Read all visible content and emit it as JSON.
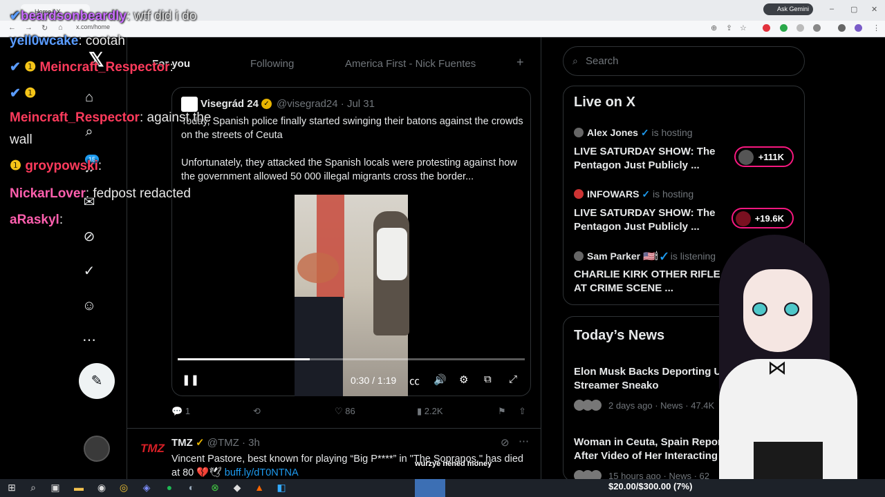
{
  "browser": {
    "tab_title": "Home / X",
    "url": "x.com/home",
    "gemini": "Ask Gemini"
  },
  "x": {
    "logo": "𝕏",
    "tabs": [
      "For you",
      "Following",
      "America First - Nick Fuentes"
    ],
    "add_tab": "+",
    "notif_count": "15",
    "quote": {
      "name": "Visegrád 24",
      "handle": "@visegrad24 · Jul 31",
      "text1": "Today, Spanish police finally started swinging their batons against the crowds on the streets of Ceuta",
      "text2": "Unfortunately, they attacked the Spanish locals were protesting against how the government allowed 50 000 illegal migrants cross the border..."
    },
    "video": {
      "time": "0:30 / 1:19",
      "progress": 0.38
    },
    "actions": {
      "replies": "1",
      "likes": "86",
      "views": "2.2K"
    },
    "tmz": {
      "logo": "TMZ",
      "name": "TMZ",
      "handle": "@TMZ · 3h",
      "text": "Vincent Pastore, best known for playing “Big P****” in \"The Sopranos,\" has died at 80 💔🕊",
      "link": "buff.ly/dT0NTNA"
    }
  },
  "right": {
    "search_placeholder": "Search",
    "live": {
      "title": "Live on X",
      "items": [
        {
          "host": "Alex Jones",
          "status": "is hosting",
          "title": "LIVE SATURDAY SHOW: The Pentagon Just Publicly ...",
          "count": "+111K"
        },
        {
          "host": "INFOWARS",
          "status": "is hosting",
          "title": "LIVE SATURDAY SHOW: The Pentagon Just Publicly ...",
          "count": "+19.6K"
        },
        {
          "host": "Sam Parker 🇺🇸🕯",
          "status": "is listening",
          "title": "CHARLIE KIRK OTHER RIFLE AT CRIME SCENE ..."
        }
      ]
    },
    "news": {
      "title": "Today’s News",
      "items": [
        {
          "title": "Elon Musk Backs Deporting U.S. Streamer Sneako",
          "meta": "2 days ago · News · 47.4K"
        },
        {
          "title": "Woman in Ceuta, Spain Report After Video of Her Interacting",
          "meta": "15 hours ago · News · 62"
        }
      ]
    }
  },
  "chat": [
    {
      "user": "beardsonbeardly",
      "color": "#c86bff",
      "msg": ": wtf did i do"
    },
    {
      "user": "yell0wcake",
      "color": "#5a9cff",
      "msg": ": cootah"
    },
    {
      "user": "Meincraft_Respector",
      "color": "#ff3b5c",
      "msg": ":"
    },
    {
      "user": "Meincraft_Respector",
      "color": "#ff3b5c",
      "msg": ": against the"
    },
    {
      "user": "",
      "color": "#fff",
      "msg": "wall"
    },
    {
      "user": "groypowski",
      "color": "#ff3b5c",
      "msg": ":"
    },
    {
      "user": "NickarLover",
      "color": "#ff5fae",
      "msg": ": fedpost redacted"
    },
    {
      "user": "aRaskyl",
      "color": "#ff5fae",
      "msg": ":"
    }
  ],
  "overlay": {
    "sub_note": "wurzye nened money",
    "goal": "$20.00/$300.00 (7%)"
  }
}
